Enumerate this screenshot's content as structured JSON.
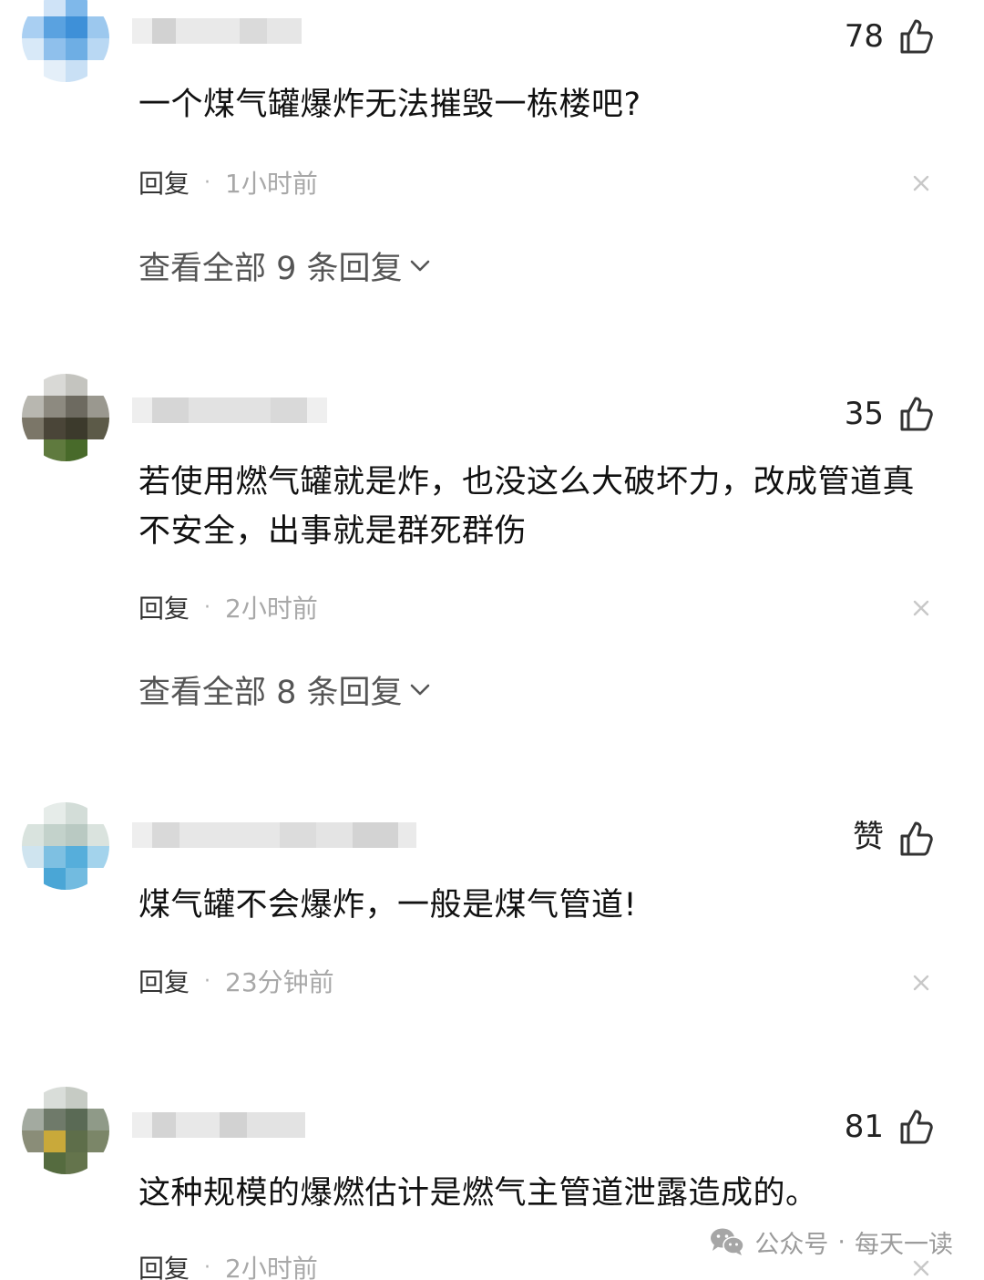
{
  "comments": [
    {
      "like_count": "78",
      "text": "一个煤气罐爆炸无法摧毁一栋楼吧?",
      "reply_label": "回复",
      "separator": "·",
      "time": "1小时前",
      "view_replies": "查看全部 9 条回复"
    },
    {
      "like_count": "35",
      "text": "若使用燃气罐就是炸，也没这么大破坏力，改成管道真不安全，出事就是群死群伤",
      "reply_label": "回复",
      "separator": "·",
      "time": "2小时前",
      "view_replies": "查看全部 8 条回复"
    },
    {
      "like_count": "赞",
      "text": "煤气罐不会爆炸，一般是煤气管道!",
      "reply_label": "回复",
      "separator": "·",
      "time": "23分钟前"
    },
    {
      "like_count": "81",
      "text": "这种规模的爆燃估计是燃气主管道泄露造成的。",
      "reply_label": "回复",
      "separator": "·",
      "time": "2小时前"
    }
  ],
  "icons": {
    "like": "thumbs-up-icon",
    "dismiss": "close-icon",
    "expand": "chevron-down-icon",
    "watermark": "wechat-icon"
  },
  "watermark": {
    "source": "公众号",
    "separator": "·",
    "name": "每天一读"
  },
  "colors": {
    "text": "#111111",
    "muted": "#a8a8a8",
    "link": "#555555"
  }
}
